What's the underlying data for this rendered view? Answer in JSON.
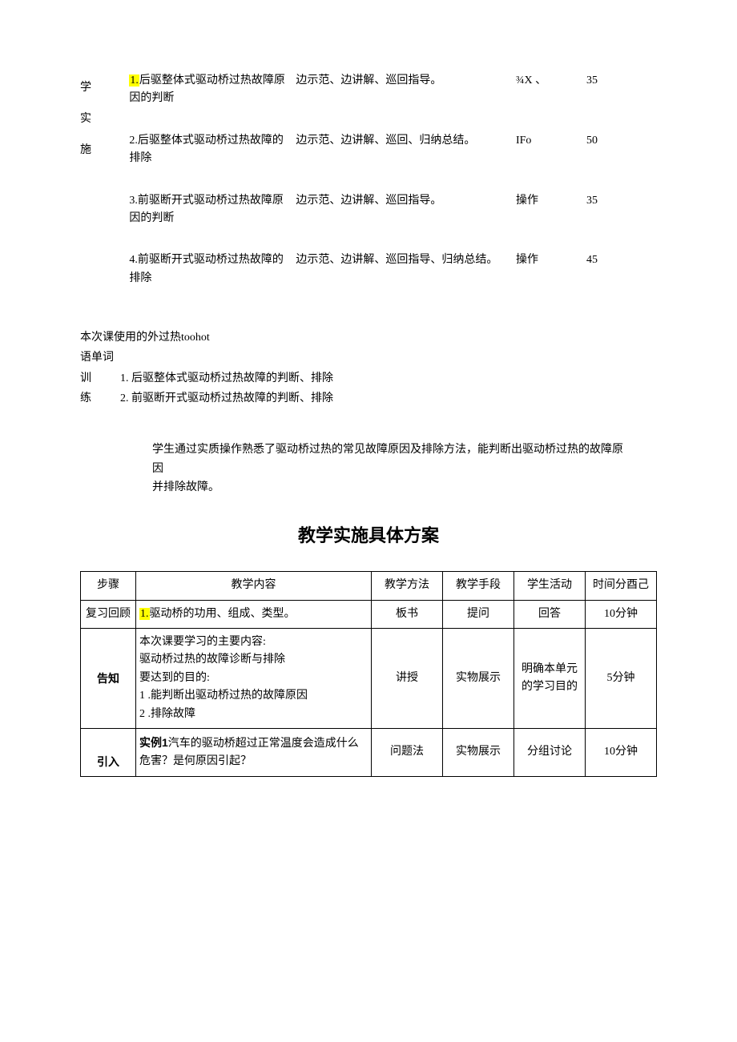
{
  "upper": {
    "sideLabel": "学实施",
    "rows": [
      {
        "content": "1.后驱整体式驱动桥过热故障原因的判断",
        "numPrefix": "1.",
        "numHl": true,
        "method": "边示范、边讲解、巡回指导。",
        "item": "¾X  、",
        "time": "35"
      },
      {
        "content": "2.后驱整体式驱动桥过热故障的排除",
        "method": "边示范、边讲解、巡回、归纳总结。",
        "item": "IFo",
        "time": "50"
      },
      {
        "content": "3.前驱断开式驱动桥过热故障原因的判断",
        "method": "边示范、边讲解、巡回指导。",
        "item": "操作",
        "time": "35"
      },
      {
        "content": "4.前驱断开式驱动桥过热故障的排除",
        "method": "边示范、边讲解、巡回指导、归纳总结。",
        "item": "操作",
        "time": "45"
      }
    ]
  },
  "vocab": {
    "line1": "本次课使用的外过热toohot",
    "line2": "语单词",
    "trainLabel1": "训",
    "trainLabel2": "练",
    "train1": "1. 后驱整体式驱动桥过热故障的判断、排除",
    "train2": "2. 前驱断开式驱动桥过热故障的判断、排除"
  },
  "summary": {
    "p1": "学生通过实质操作熟悉了驱动桥过热的常见故障原因及排除方法，能判断出驱动桥过热的故障原因",
    "p2": "并排除故障。"
  },
  "planTitle": "教学实施具体方案",
  "plan": {
    "headers": {
      "step": "步骤",
      "content": "教学内容",
      "method": "教学方法",
      "means": "教学手段",
      "activity": "学生活动",
      "time": "时间分酉己"
    },
    "rows": [
      {
        "step": "复习回顾",
        "contentPrefix": "1.",
        "contentPrefixHl": true,
        "content": "驱动桥的功用、组成、类型。",
        "method": "板书",
        "means": "提问",
        "activity": "回答",
        "time": "10分钟"
      },
      {
        "step": "告知",
        "contentLines": [
          "本次课要学习的主要内容:",
          "驱动桥过热的故障诊断与排除",
          "要达到的目的:",
          "1          .能判断出驱动桥过热的故障原因",
          "2          .排除故障"
        ],
        "method": "讲授",
        "means": "实物展示",
        "activity": "明确本单元的学习目的",
        "time": "5分钟"
      },
      {
        "step": "引入",
        "contentBoldPrefix": "实例1",
        "content": "汽车的驱动桥超过正常温度会造成什么危害？是何原因引起？",
        "method": "问题法",
        "means": "实物展示",
        "activity": "分组讨论",
        "time": "10分钟"
      }
    ]
  }
}
